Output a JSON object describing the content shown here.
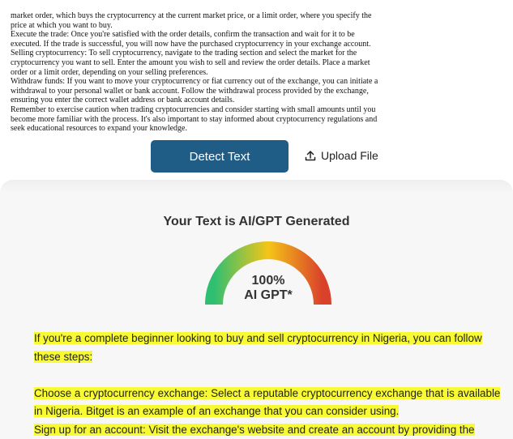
{
  "input_text": {
    "lines": [
      "market order, which buys the cryptocurrency at the current market price, or a limit order, where you specify the",
      "price at which you want to buy.",
      "Execute the trade: Once you're satisfied with the order details, confirm the transaction and wait for it to be",
      "executed. If the trade is successful, you will now have the purchased cryptocurrency in your exchange account.",
      "Selling cryptocurrency: To sell cryptocurrency, navigate to the trading section and select the market for the",
      "cryptocurrency you want to sell. Enter the amount you wish to sell and review the order details. Place a market",
      "order or a limit order, depending on your selling preferences.",
      "Withdraw funds: If you want to move your cryptocurrency or fiat currency out of the exchange, you can initiate a",
      "withdrawal to your personal wallet or bank account. Follow the withdrawal process provided by the exchange,",
      "ensuring you enter the correct wallet address or bank account details.",
      "Remember to exercise caution when trading cryptocurrencies and consider starting with small amounts until you",
      "become more familiar with the process. It's also important to stay informed about cryptocurrency regulations and",
      "seek educational resources to expand your knowledge."
    ]
  },
  "actions": {
    "detect_label": "Detect Text",
    "upload_label": "Upload File"
  },
  "result": {
    "title": "Your Text is AI/GPT Generated",
    "percent": "100%",
    "percent_value": 100,
    "label": "AI GPT*",
    "highlight_color": "#f8fb34",
    "gauge_colors": [
      "#2fbf71",
      "#f5c518",
      "#d9412b"
    ]
  },
  "highlighted_text": {
    "lines": [
      "If you're a complete beginner looking to buy and sell cryptocurrency in Nigeria, you can follow",
      "these steps:",
      "",
      "Choose a cryptocurrency exchange: Select a reputable cryptocurrency exchange that is available",
      "in Nigeria. Bitget is an example of an exchange that you can consider using.",
      "Sign up for an account: Visit the exchange's website and create an account by providing the"
    ]
  }
}
